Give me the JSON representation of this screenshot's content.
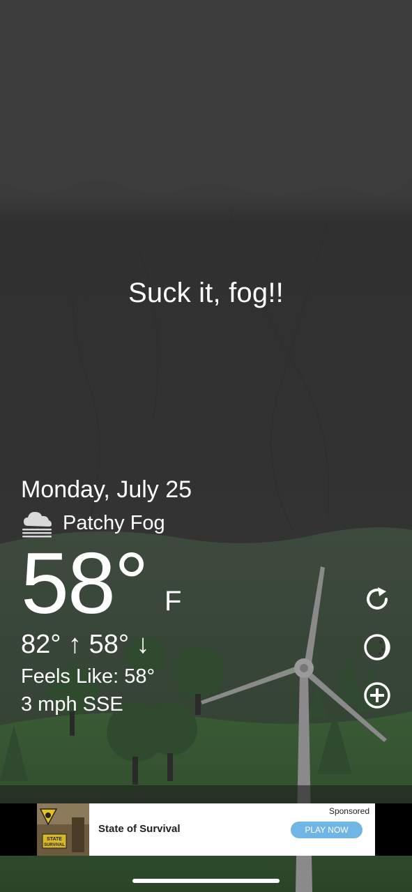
{
  "headline": "Suck it, fog!!",
  "weather": {
    "date": "Monday, July 25",
    "condition": "Patchy Fog",
    "condition_icon": "fog-cloud-icon",
    "temperature": "58°",
    "unit": "F",
    "high_low": "82° ↑  58° ↓",
    "feels_like": "Feels Like: 58°",
    "wind": "3 mph SSE"
  },
  "actions": [
    {
      "icon": "refresh-icon"
    },
    {
      "icon": "moon-icon"
    },
    {
      "icon": "add-icon"
    }
  ],
  "ad": {
    "sponsored": "Sponsored",
    "title": "State of Survival",
    "cta": "PLAY NOW",
    "thumb_text": "STATE SURVIVAL"
  },
  "colors": {
    "sky_top": "#3d3d3d",
    "sky": "#323232",
    "hill": "#2d4a2d",
    "ad_button": "#6fb6e6"
  }
}
